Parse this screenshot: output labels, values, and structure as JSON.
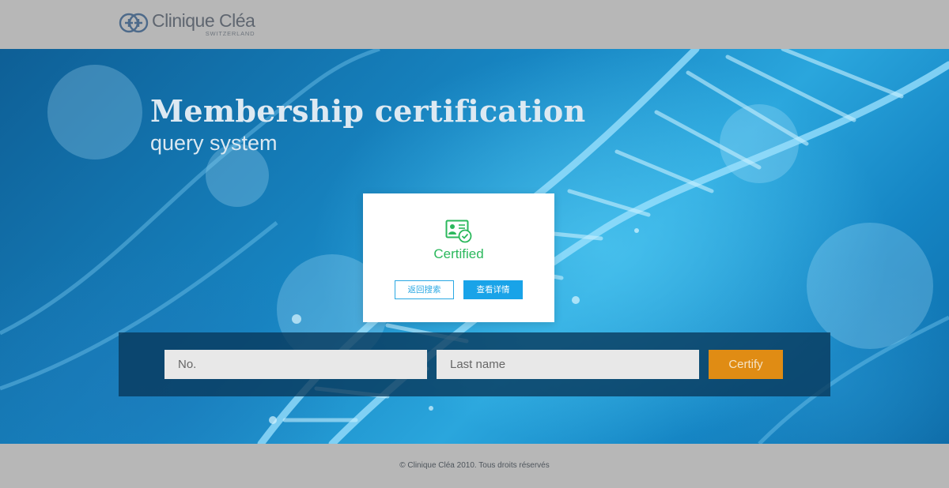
{
  "header": {
    "brand_name": "Clinique Cléa",
    "brand_sub": "SWITZERLAND",
    "logo_icon": "cross-plus-logo-icon"
  },
  "hero": {
    "title": "Membership certification",
    "subtitle": "query system"
  },
  "result_dialog": {
    "icon": "id-card-check-icon",
    "status": "Certified",
    "back_label": "返回搜索",
    "detail_label": "查看详情"
  },
  "search": {
    "number_placeholder": "No.",
    "number_value": "",
    "last_name_placeholder": "Last name",
    "last_name_value": "",
    "submit_label": "Certify"
  },
  "footer": {
    "copyright": "© Clinique Cléa 2010. Tous droits réservés"
  },
  "colors": {
    "accent_blue": "#19a3e8",
    "certified_green": "#2bb85c",
    "certify_orange": "#e08c14",
    "bar_gray": "#b7b7b7"
  }
}
